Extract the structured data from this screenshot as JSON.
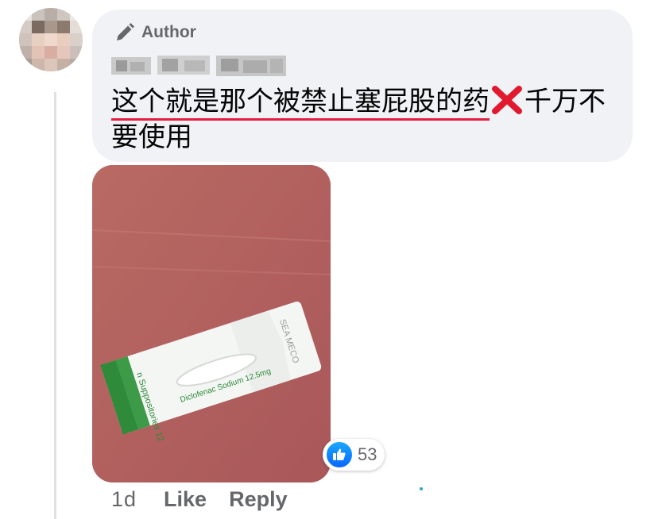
{
  "comment": {
    "badge_label": "Author",
    "commenter_name": "",
    "text_highlighted": "这个就是那个被禁止塞屁股的药",
    "text_after_mark": "千万不要使用",
    "cross_mark": "❌",
    "attachment_printed_text": {
      "label_left": "n Suppositories 12",
      "label_drug": "Diclofenac Sodium 12.5mg",
      "label_right": "SEA MECO"
    },
    "reaction_icon": "like-icon",
    "reaction_count": "53",
    "timestamp": "1d",
    "actions": {
      "like": "Like",
      "reply": "Reply"
    }
  },
  "colors": {
    "bubble_bg": "#f0f2f5",
    "text": "#050505",
    "muted": "#65676b",
    "underline": "#e41e3f",
    "like_blue": "#0866ff",
    "photo_bg": "#b4655f",
    "packet_green": "#2f8a3a"
  }
}
